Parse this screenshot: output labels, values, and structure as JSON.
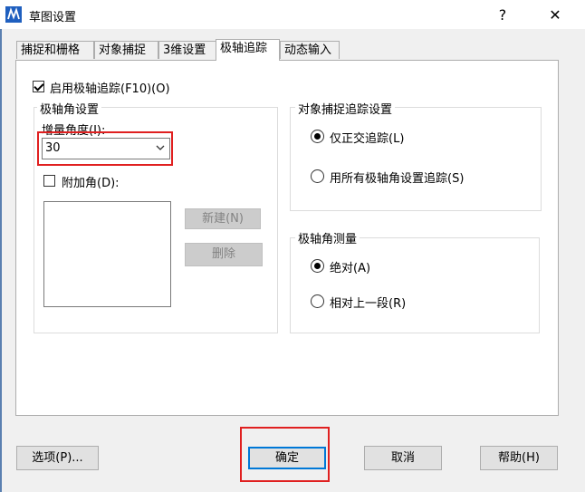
{
  "window": {
    "title": "草图设置",
    "help_glyph": "?",
    "close_glyph": "✕"
  },
  "tabs": [
    {
      "label": "捕捉和栅格",
      "active": false
    },
    {
      "label": "对象捕捉",
      "active": false
    },
    {
      "label": "3维设置",
      "active": false
    },
    {
      "label": "极轴追踪",
      "active": true
    },
    {
      "label": "动态输入",
      "active": false
    }
  ],
  "polar": {
    "enable_label": "启用极轴追踪(F10)(O)",
    "enable_checked": true,
    "angle_group_title": "极轴角设置",
    "increment_label": "增量角度(I):",
    "increment_value": "30",
    "additional_label": "附加角(D):",
    "additional_checked": false,
    "new_button": "新建(N)",
    "delete_button": "删除"
  },
  "osnap_tracking": {
    "group_title": "对象捕捉追踪设置",
    "options": [
      {
        "label": "仅正交追踪(L)",
        "checked": true
      },
      {
        "label": "用所有极轴角设置追踪(S)",
        "checked": false
      }
    ]
  },
  "polar_measure": {
    "group_title": "极轴角测量",
    "options": [
      {
        "label": "绝对(A)",
        "checked": true
      },
      {
        "label": "相对上一段(R)",
        "checked": false
      }
    ]
  },
  "footer": {
    "options_button": "选项(P)...",
    "ok_button": "确定",
    "cancel_button": "取消",
    "help_button": "帮助(H)"
  },
  "colors": {
    "highlight": "#e02020",
    "default_button_border": "#0078d7"
  }
}
